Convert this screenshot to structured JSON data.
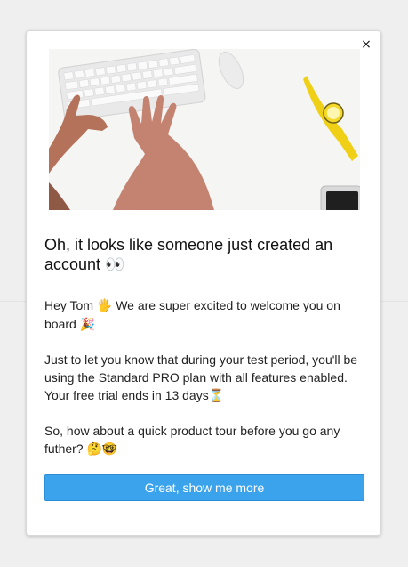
{
  "modal": {
    "close_label": "×",
    "title_text": "Oh, it looks like someone just created an account",
    "title_emoji": "👀",
    "paragraph1": {
      "before": "Hey Tom ",
      "wave_emoji": "🖐",
      "middle": " We are super excited to welcome you on board ",
      "party_emoji": "🎉"
    },
    "paragraph2": {
      "text": "Just to let you know that during your test period, you'll be using the Standard PRO plan with all features enabled. Your free trial ends in 13 days",
      "hourglass_emoji": "⏳"
    },
    "paragraph3": {
      "text": "So, how about a quick product tour before you go any futher? ",
      "thinking_emoji": "🤔",
      "nerd_emoji": "🤓"
    },
    "cta_label": "Great, show me more"
  },
  "colors": {
    "accent": "#3ba3ec",
    "background": "#efefef",
    "card": "#ffffff"
  }
}
